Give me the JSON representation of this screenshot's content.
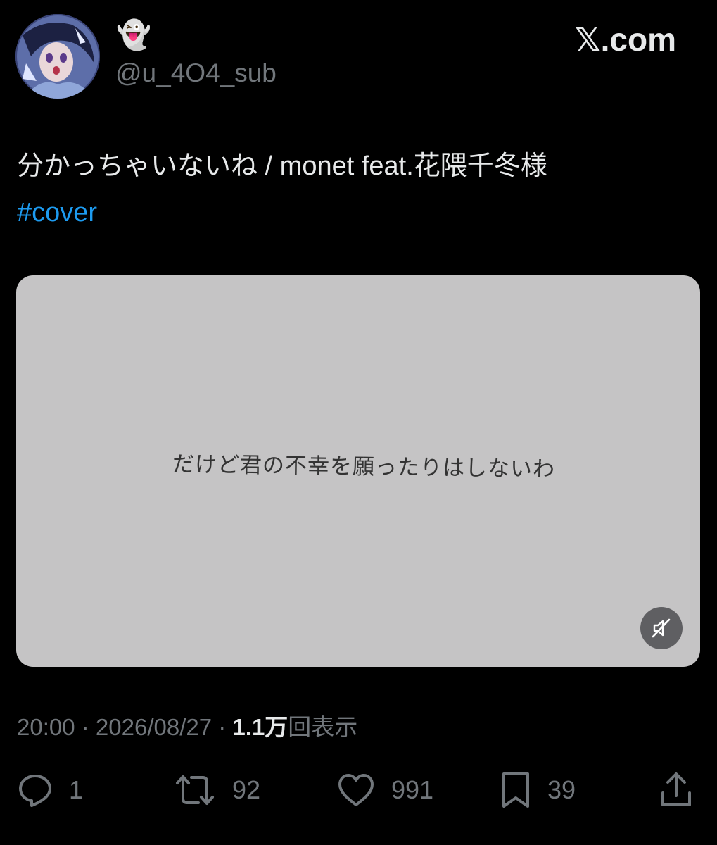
{
  "author": {
    "display_name": "👻",
    "handle": "@u_4O4_sub"
  },
  "brand": "𝕏.com",
  "post": {
    "text": "分かっちゃいないね / monet feat.花隈千冬様",
    "hashtag": "#cover"
  },
  "media": {
    "caption": "だけど君の不幸を願ったりはしないわ",
    "mute_icon": "speaker-muted-icon"
  },
  "meta": {
    "time": "20:00",
    "separator": " · ",
    "date": "2026/08/27",
    "views": "1.1万",
    "views_label": "回表示"
  },
  "actions": {
    "reply": {
      "icon": "reply-icon",
      "count": "1"
    },
    "repost": {
      "icon": "repost-icon",
      "count": "92"
    },
    "like": {
      "icon": "heart-icon",
      "count": "991"
    },
    "bookmark": {
      "icon": "bookmark-icon",
      "count": "39"
    },
    "share": {
      "icon": "share-icon"
    }
  },
  "colors": {
    "background": "#000000",
    "text": "#e7e9ea",
    "muted": "#71767b",
    "link": "#1d9bf0",
    "media_bg": "#c5c4c5"
  }
}
